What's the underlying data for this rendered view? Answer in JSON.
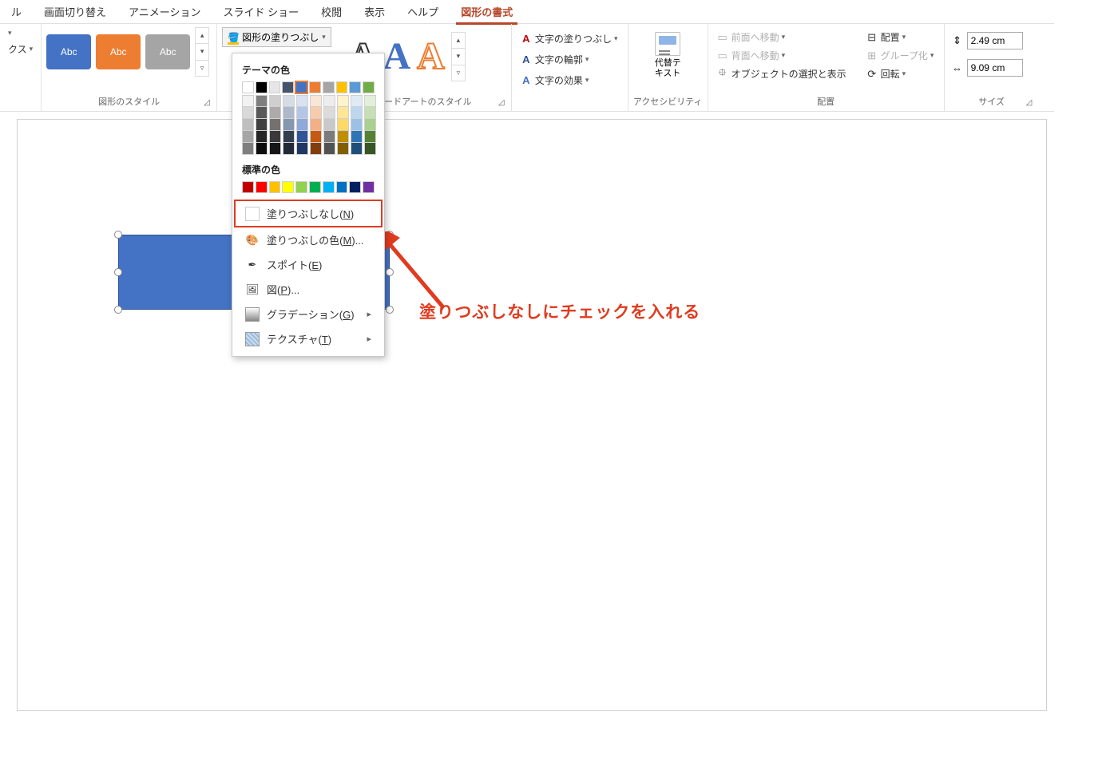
{
  "tabs": [
    "ル",
    "画面切り替え",
    "アニメーション",
    "スライド ショー",
    "校閲",
    "表示",
    "ヘルプ",
    "図形の書式"
  ],
  "active_tab_index": 7,
  "groups": {
    "insert": {
      "label": "クス"
    },
    "styles": {
      "label": "図形のスタイル",
      "thumb_text": "Abc"
    },
    "wordart": {
      "label": "ワードアートのスタイル"
    },
    "acc": {
      "label": "アクセシビリティ",
      "alt_text_top": "代替テ",
      "alt_text_bottom": "キスト"
    },
    "arrange": {
      "label": "配置",
      "bring_forward": "前面へ移動",
      "send_backward": "背面へ移動",
      "selection_pane": "オブジェクトの選択と表示",
      "align": "配置",
      "group": "グループ化",
      "rotate": "回転"
    },
    "size": {
      "label": "サイズ",
      "height": "2.49 cm",
      "width": "9.09 cm"
    }
  },
  "fill_button": "図形の塗りつぶし",
  "text_buttons": {
    "fill": "文字の塗りつぶし",
    "outline": "文字の輪郭",
    "effects": "文字の効果"
  },
  "popup": {
    "theme_label": "テーマの色",
    "standard_label": "標準の色",
    "no_fill_prefix": "塗りつぶしなし(",
    "no_fill_key": "N",
    "no_fill_suffix": ")",
    "more_colors_prefix": "塗りつぶしの色(",
    "more_colors_key": "M",
    "more_colors_suffix": ")...",
    "eyedropper_prefix": "スポイト(",
    "eyedropper_key": "E",
    "eyedropper_suffix": ")",
    "picture_prefix": "図(",
    "picture_key": "P",
    "picture_suffix": ")...",
    "gradient_prefix": "グラデーション(",
    "gradient_key": "G",
    "gradient_suffix": ")",
    "texture_prefix": "テクスチャ(",
    "texture_key": "T",
    "texture_suffix": ")",
    "theme_colors": [
      "#ffffff",
      "#000000",
      "#e7e6e6",
      "#44546a",
      "#4472c4",
      "#ed7d31",
      "#a5a5a5",
      "#ffc000",
      "#5b9bd5",
      "#70ad47"
    ],
    "selected_theme_index": 4,
    "tints": [
      [
        "#f2f2f2",
        "#d9d9d9",
        "#bfbfbf",
        "#a6a6a6",
        "#7f7f7f"
      ],
      [
        "#7f7f7f",
        "#595959",
        "#404040",
        "#262626",
        "#0d0d0d"
      ],
      [
        "#d0cece",
        "#aeaaaa",
        "#757171",
        "#3a3838",
        "#161616"
      ],
      [
        "#d6dce5",
        "#adb9ca",
        "#8497b0",
        "#333f50",
        "#222a35"
      ],
      [
        "#d9e1f2",
        "#b4c6e7",
        "#8ea9db",
        "#305496",
        "#203764"
      ],
      [
        "#fbe5d6",
        "#f8cbad",
        "#f4b084",
        "#c65911",
        "#833c0c"
      ],
      [
        "#ededed",
        "#dbdbdb",
        "#c9c9c9",
        "#7b7b7b",
        "#525252"
      ],
      [
        "#fff2cc",
        "#ffe699",
        "#ffd966",
        "#bf8f00",
        "#806000"
      ],
      [
        "#deebf7",
        "#bdd7ee",
        "#9bc2e6",
        "#2f75b5",
        "#1f4e78"
      ],
      [
        "#e2efda",
        "#c6e0b4",
        "#a9d08e",
        "#548235",
        "#375623"
      ]
    ],
    "standard_colors": [
      "#c00000",
      "#ff0000",
      "#ffc000",
      "#ffff00",
      "#92d050",
      "#00b050",
      "#00b0f0",
      "#0070c0",
      "#002060",
      "#7030a0"
    ]
  },
  "annotation_text": "塗りつぶしなしにチェックを入れる"
}
